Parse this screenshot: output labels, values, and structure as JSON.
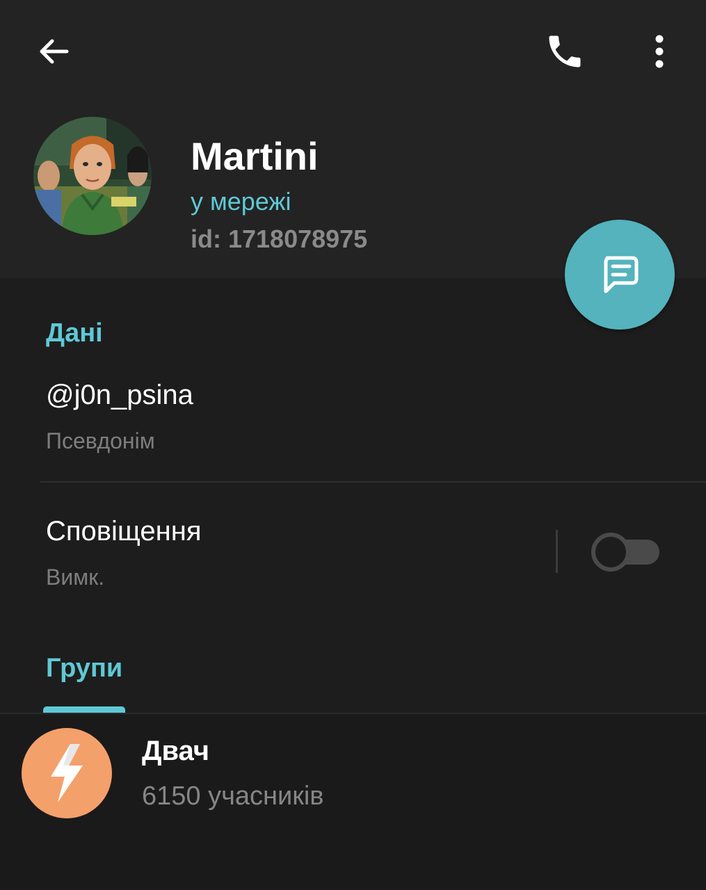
{
  "header": {
    "back_icon": "arrow-left-icon",
    "call_icon": "phone-icon",
    "more_icon": "more-vertical-icon"
  },
  "profile": {
    "name": "Martini",
    "status": "у мережі",
    "id": "id: 1718078975",
    "avatar_icon": "user-avatar-image"
  },
  "fab": {
    "icon": "message-icon",
    "color": "#54b3bd"
  },
  "info_section": {
    "title": "Дані",
    "username": "@j0n_psina",
    "username_caption": "Псевдонім",
    "notifications_label": "Сповіщення",
    "notifications_value": "Вимк.",
    "notifications_enabled": false
  },
  "groups_section": {
    "title": "Групи",
    "groups": [
      {
        "name": "Двач",
        "members": "6150 учасників",
        "icon": "lightning-icon",
        "color": "#f4a06b"
      }
    ]
  },
  "colors": {
    "accent": "#5fc8d6",
    "background": "#1d1d1d",
    "header_background": "#232323"
  }
}
